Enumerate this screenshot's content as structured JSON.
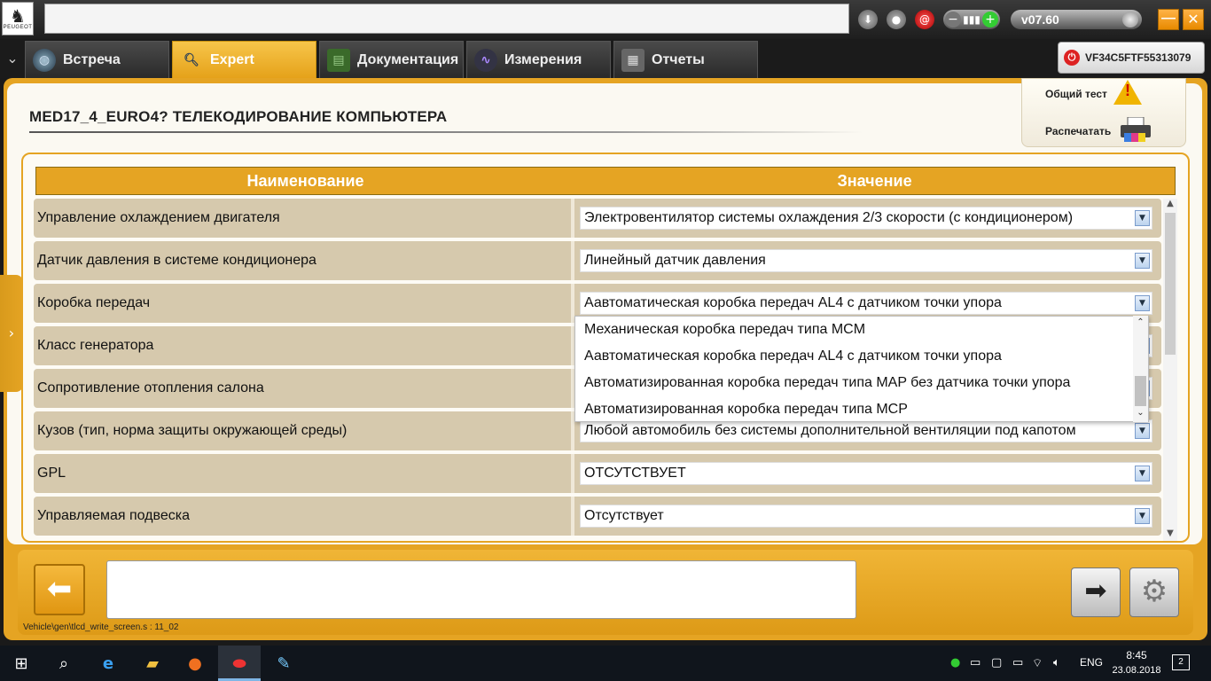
{
  "topbar": {
    "logo_text": "PEUGEOT",
    "search_value": "",
    "version": "v07.60"
  },
  "tabs": [
    {
      "label": "Встреча"
    },
    {
      "label": "Expert"
    },
    {
      "label": "Документация"
    },
    {
      "label": "Измерения"
    },
    {
      "label": "Отчеты"
    }
  ],
  "vin": "VF34C5FTF55313079",
  "page": {
    "title": "MED17_4_EURO4?  ТЕЛЕКОДИРОВАНИЕ КОМПЬЮТЕРА",
    "general_test": "Общий тест",
    "print": "Распечатать"
  },
  "table": {
    "headers": {
      "name": "Наименование",
      "value": "Значение"
    },
    "rows": [
      {
        "name": "Управление охлаждением двигателя",
        "value": "Электровентилятор системы охлаждения 2/3 скорости (с кондиционером)"
      },
      {
        "name": "Датчик давления в системе кондиционера",
        "value": "Линейный датчик давления"
      },
      {
        "name": "Коробка передач",
        "value": "Аавтоматическая коробка передач AL4 с датчиком точки упора"
      },
      {
        "name": "Класс генератора",
        "value": ""
      },
      {
        "name": "Сопротивление отопления салона",
        "value": ""
      },
      {
        "name": "Кузов (тип, норма защиты окружающей среды)",
        "value": "Любой автомобиль без системы дополнительной вентиляции под капотом"
      },
      {
        "name": "GPL",
        "value": "ОТСУТСТВУЕТ"
      },
      {
        "name": "Управляемая подвеска",
        "value": "Отсутствует"
      }
    ]
  },
  "dropdown": {
    "options": [
      "Механическая коробка передач типа MCM",
      "Аавтоматическая коробка передач AL4 с датчиком точки упора",
      "Автоматизированная коробка передач типа MAP без датчика точки упора",
      "Автоматизированная коробка передач типа MCP"
    ]
  },
  "footer": {
    "message": "",
    "script_path": "Vehicle\\gen\\tlcd_write_screen.s : 11_02"
  },
  "taskbar": {
    "lang": "ENG",
    "time": "8:45",
    "date": "23.08.2018",
    "notifications": "2"
  },
  "icons": {
    "back": "arrow-left-icon",
    "next": "arrow-right-icon",
    "config": "gear-icon",
    "warning": "warning-icon",
    "printer": "printer-icon"
  },
  "colors": {
    "accent": "#e5a423",
    "row_bg": "#d6c9ad"
  }
}
